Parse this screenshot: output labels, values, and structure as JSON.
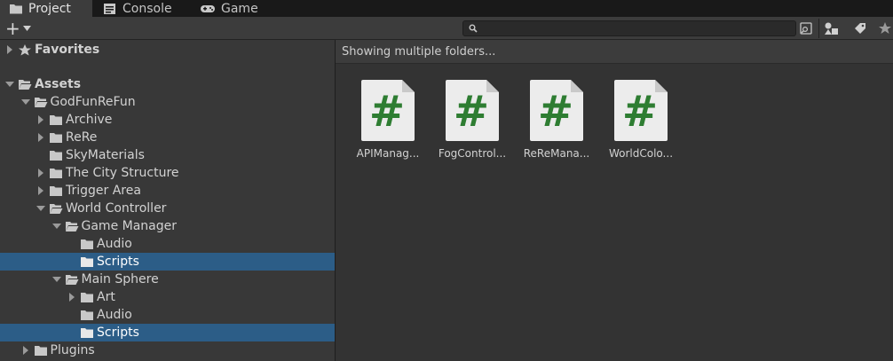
{
  "tabs": [
    {
      "label": "Project",
      "icon": "folder-icon",
      "active": true
    },
    {
      "label": "Console",
      "icon": "console-icon",
      "active": false
    },
    {
      "label": "Game",
      "icon": "gamepad-icon",
      "active": false
    }
  ],
  "toolbar": {
    "create_label": "+",
    "search_value": "",
    "buttons": [
      "search-by-type-icon",
      "filter-by-type-icon",
      "filter-by-label-icon",
      "favorite-icon"
    ]
  },
  "tree": {
    "items": [
      {
        "label": "Favorites",
        "icon": "star-icon",
        "depth": 0,
        "expand": "collapsed",
        "selected": false,
        "bold": true
      },
      {
        "label": "Assets",
        "icon": "folder-open-icon",
        "depth": 0,
        "expand": "expanded",
        "selected": false,
        "bold": true
      },
      {
        "label": "GodFunReFun",
        "icon": "folder-open-icon",
        "depth": 1,
        "expand": "expanded",
        "selected": false,
        "bold": false
      },
      {
        "label": "Archive",
        "icon": "folder-icon",
        "depth": 2,
        "expand": "collapsed",
        "selected": false,
        "bold": false
      },
      {
        "label": "ReRe",
        "icon": "folder-icon",
        "depth": 2,
        "expand": "collapsed",
        "selected": false,
        "bold": false
      },
      {
        "label": "SkyMaterials",
        "icon": "folder-icon",
        "depth": 2,
        "expand": "none",
        "selected": false,
        "bold": false
      },
      {
        "label": "The City Structure",
        "icon": "folder-icon",
        "depth": 2,
        "expand": "collapsed",
        "selected": false,
        "bold": false
      },
      {
        "label": "Trigger Area",
        "icon": "folder-icon",
        "depth": 2,
        "expand": "collapsed",
        "selected": false,
        "bold": false
      },
      {
        "label": "World Controller",
        "icon": "folder-open-icon",
        "depth": 2,
        "expand": "expanded",
        "selected": false,
        "bold": false
      },
      {
        "label": "Game Manager",
        "icon": "folder-open-icon",
        "depth": 3,
        "expand": "expanded",
        "selected": false,
        "bold": false
      },
      {
        "label": "Audio",
        "icon": "folder-icon",
        "depth": 4,
        "expand": "none",
        "selected": false,
        "bold": false
      },
      {
        "label": "Scripts",
        "icon": "folder-icon",
        "depth": 4,
        "expand": "none",
        "selected": true,
        "bold": false
      },
      {
        "label": "Main Sphere",
        "icon": "folder-open-icon",
        "depth": 3,
        "expand": "expanded",
        "selected": false,
        "bold": false
      },
      {
        "label": "Art",
        "icon": "folder-icon",
        "depth": 4,
        "expand": "collapsed",
        "selected": false,
        "bold": false
      },
      {
        "label": "Audio",
        "icon": "folder-icon",
        "depth": 4,
        "expand": "none",
        "selected": false,
        "bold": false
      },
      {
        "label": "Scripts",
        "icon": "folder-icon",
        "depth": 4,
        "expand": "none",
        "selected": true,
        "bold": false
      },
      {
        "label": "Plugins",
        "icon": "folder-icon",
        "depth": 1,
        "expand": "collapsed",
        "selected": false,
        "bold": false
      }
    ]
  },
  "content": {
    "header": "Showing multiple folders...",
    "assets": [
      {
        "label": "APIManag...",
        "icon": "csharp-script-icon"
      },
      {
        "label": "FogControl...",
        "icon": "csharp-script-icon"
      },
      {
        "label": "ReReMana...",
        "icon": "csharp-script-icon"
      },
      {
        "label": "WorldColo...",
        "icon": "csharp-script-icon"
      }
    ]
  },
  "colors": {
    "selection": "#2c5d87",
    "script_hash": "#2e7d32",
    "panel_bg": "#383838"
  }
}
